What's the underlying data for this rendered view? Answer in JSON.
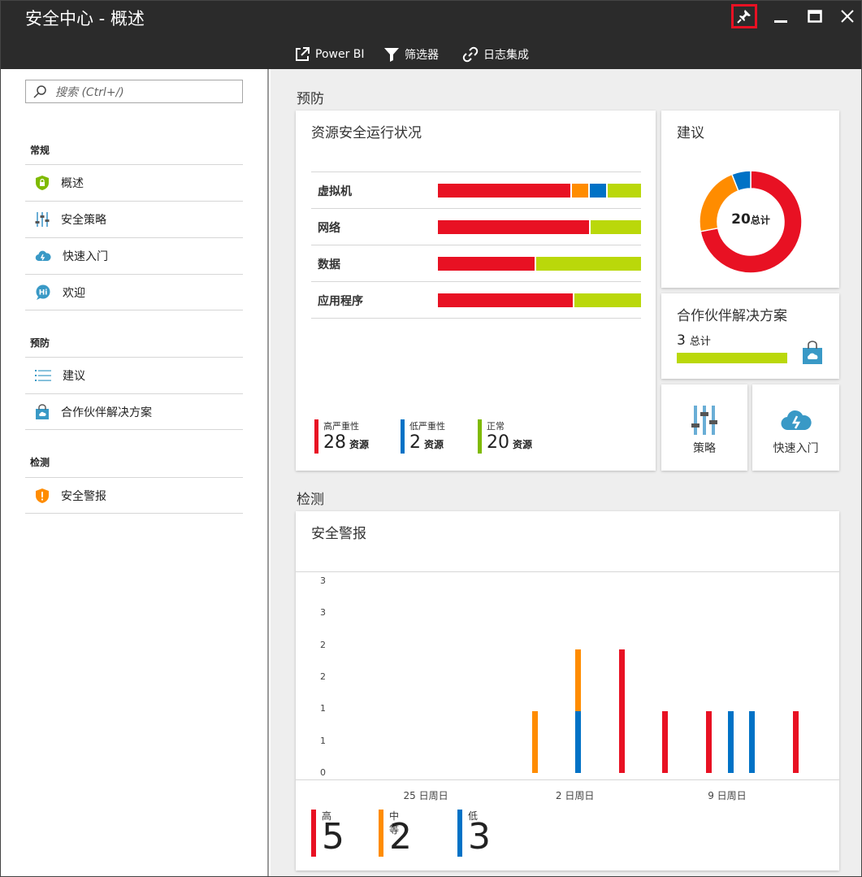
{
  "window": {
    "title": "安全中心 - 概述"
  },
  "toolbar": {
    "powerbi": "Power BI",
    "filter": "筛选器",
    "log": "日志集成"
  },
  "search": {
    "placeholder": "搜索 (Ctrl+/)"
  },
  "nav": {
    "general_label": "常规",
    "general": [
      {
        "label": "概述",
        "icon": "shield-lock-icon"
      },
      {
        "label": "安全策略",
        "icon": "sliders-icon"
      },
      {
        "label": "快速入门",
        "icon": "cloud-icon"
      },
      {
        "label": "欢迎",
        "icon": "hi-bubble-icon"
      }
    ],
    "prevention_label": "预防",
    "prevention": [
      {
        "label": "建议",
        "icon": "list-icon"
      },
      {
        "label": "合作伙伴解决方案",
        "icon": "shopping-bag-icon"
      }
    ],
    "detection_label": "检测",
    "detection": [
      {
        "label": "安全警报",
        "icon": "shield-alert-icon"
      }
    ]
  },
  "prevention": {
    "section_title": "预防",
    "health": {
      "title": "资源安全运行状况",
      "rows": [
        {
          "label": "虚拟机",
          "segments": [
            {
              "value": 0.67,
              "color": "#e81123"
            },
            {
              "value": 0.08,
              "color": "#ff8c00"
            },
            {
              "value": 0.08,
              "color": "#0072c6"
            },
            {
              "value": 0.17,
              "color": "#bad80a"
            }
          ]
        },
        {
          "label": "网络",
          "segments": [
            {
              "value": 0.75,
              "color": "#e81123"
            },
            {
              "value": 0.25,
              "color": "#bad80a"
            }
          ]
        },
        {
          "label": "数据",
          "segments": [
            {
              "value": 0.48,
              "color": "#e81123"
            },
            {
              "value": 0.52,
              "color": "#bad80a"
            }
          ]
        },
        {
          "label": "应用程序",
          "segments": [
            {
              "value": 0.67,
              "color": "#e81123"
            },
            {
              "value": 0.33,
              "color": "#bad80a"
            }
          ]
        }
      ],
      "legend": [
        {
          "caption": "高严重性",
          "count": "28",
          "unit": "资源",
          "color": "#e81123"
        },
        {
          "caption": "低严重性",
          "count": "2",
          "unit": "资源",
          "color": "#0072c6"
        },
        {
          "caption": "正常",
          "count": "20",
          "unit": "资源",
          "color": "#7fba00"
        }
      ]
    },
    "recommendations": {
      "title": "建议",
      "total": "20",
      "total_label": "总计",
      "slices": [
        {
          "value": 0.72,
          "color": "#e81123"
        },
        {
          "value": 0.22,
          "color": "#ff8c00"
        },
        {
          "value": 0.06,
          "color": "#0072c6"
        }
      ]
    },
    "partners": {
      "title": "合作伙伴解决方案",
      "count": "3",
      "count_label": "总计",
      "progress": 1.0,
      "bar_color": "#bad80a"
    },
    "tiles": {
      "policy": "策略",
      "quickstart": "快速入门"
    }
  },
  "detection": {
    "section_title": "检测",
    "alerts_title": "安全警报",
    "legend": [
      {
        "caption": "高",
        "count": "5",
        "color": "#e81123"
      },
      {
        "caption": "中等",
        "count": "2",
        "color": "#ff8c00"
      },
      {
        "caption": "低",
        "count": "3",
        "color": "#0072c6"
      }
    ]
  },
  "chart_data": {
    "type": "bar",
    "stacked": true,
    "title": "安全警报",
    "y_tick_labels": [
      "3",
      "3",
      "2",
      "2",
      "1",
      "1",
      "0"
    ],
    "ylim": [
      0,
      3
    ],
    "x_tick_labels": [
      "25 日周日",
      "2 日周日",
      "9 日周日"
    ],
    "x_tick_days": [
      0,
      7,
      14
    ],
    "xlim": [
      -6,
      19
    ],
    "grid": false,
    "legend_position": "bottom",
    "series": [
      {
        "name": "高",
        "color": "#e81123",
        "points": [
          {
            "day": 9,
            "value": 2
          },
          {
            "day": 11,
            "value": 1
          },
          {
            "day": 13,
            "value": 1
          },
          {
            "day": 17,
            "value": 1
          }
        ]
      },
      {
        "name": "中等",
        "color": "#ff8c00",
        "points": [
          {
            "day": 5,
            "value": 1
          },
          {
            "day": 7,
            "value": 1
          }
        ]
      },
      {
        "name": "低",
        "color": "#0072c6",
        "points": [
          {
            "day": 7,
            "value": 1
          },
          {
            "day": 14,
            "value": 1
          },
          {
            "day": 15,
            "value": 1
          }
        ]
      }
    ]
  }
}
